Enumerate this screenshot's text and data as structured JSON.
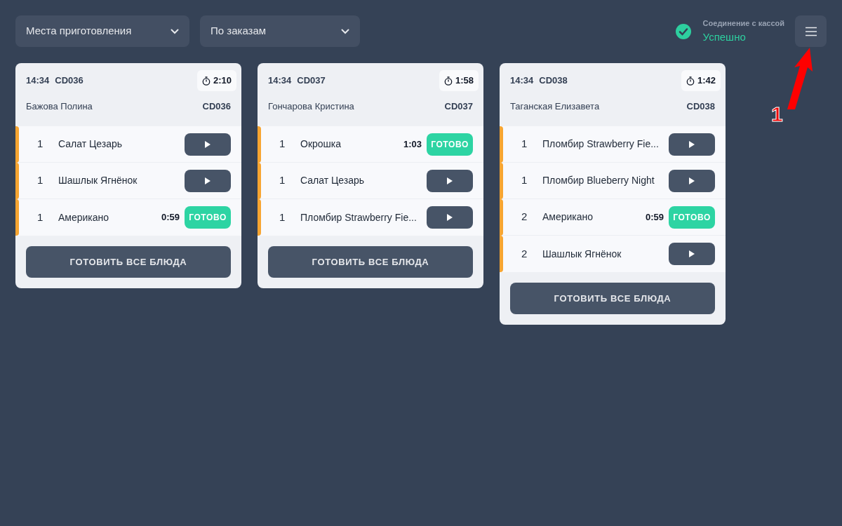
{
  "filters": [
    {
      "label": "Места приготовления"
    },
    {
      "label": "По заказам"
    }
  ],
  "connection": {
    "label": "Соединение с кассой",
    "status": "Успешно",
    "ok": true
  },
  "annotation": {
    "label": "1"
  },
  "orders": [
    {
      "time": "14:34",
      "code": "CD036",
      "timer": "2:10",
      "customer": "Бажова Полина",
      "code_right": "CD036",
      "action": "ГОТОВИТЬ ВСЕ БЛЮДА",
      "items": [
        {
          "qty": "1",
          "name": "Салат Цезарь",
          "kind": "pending"
        },
        {
          "qty": "1",
          "name": "Шашлык Ягнёнок",
          "kind": "pending"
        },
        {
          "qty": "1",
          "name": "Американо",
          "kind": "cooking",
          "elapsed": "0:59",
          "button": "ГОТОВО"
        }
      ]
    },
    {
      "time": "14:34",
      "code": "CD037",
      "timer": "1:58",
      "customer": "Гончарова Кристина",
      "code_right": "CD037",
      "action": "ГОТОВИТЬ ВСЕ БЛЮДА",
      "items": [
        {
          "qty": "1",
          "name": "Окрошка",
          "kind": "cooking",
          "elapsed": "1:03",
          "button": "ГОТОВО"
        },
        {
          "qty": "1",
          "name": "Салат Цезарь",
          "kind": "pending"
        },
        {
          "qty": "1",
          "name": "Пломбир Strawberry Fie...",
          "kind": "pending"
        }
      ]
    },
    {
      "time": "14:34",
      "code": "CD038",
      "timer": "1:42",
      "customer": "Таганская Елизавета",
      "code_right": "CD038",
      "action": "ГОТОВИТЬ ВСЕ БЛЮДА",
      "items": [
        {
          "qty": "1",
          "name": "Пломбир Strawberry Fie...",
          "kind": "pending"
        },
        {
          "qty": "1",
          "name": "Пломбир Blueberry Night",
          "kind": "pending"
        },
        {
          "qty": "2",
          "name": "Американо",
          "kind": "cooking",
          "elapsed": "0:59",
          "button": "ГОТОВО"
        },
        {
          "qty": "2",
          "name": "Шашлык Ягнёнок",
          "kind": "pending"
        }
      ]
    }
  ]
}
